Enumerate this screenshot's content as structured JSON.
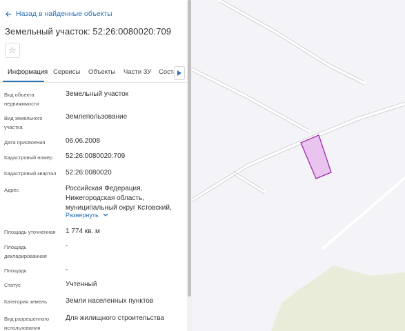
{
  "header": {
    "back_label": "Назад в найденные объекты",
    "title": "Земельный участок: 52:26:0080020:709"
  },
  "tabs": [
    {
      "label": "Информация",
      "active": true
    },
    {
      "label": "Сервисы"
    },
    {
      "label": "Объекты"
    },
    {
      "label": "Части ЗУ"
    },
    {
      "label": "Соста"
    }
  ],
  "details": [
    {
      "label": "Вид объекта недвижимости",
      "value": "Земельный участок"
    },
    {
      "label": "Вид земельного участка",
      "value": "Землепользование"
    },
    {
      "label": "Дата присвоения",
      "value": "06.06.2008"
    },
    {
      "label": "Кадастровый номер",
      "value": "52:26:0080020:709"
    },
    {
      "label": "Кадастровый квартал",
      "value": "52:26:0080020"
    },
    {
      "label": "Адрес",
      "value": "Российская Федерация, Нижегородская область, муниципальный округ Кстовский,"
    },
    {
      "label": "Площадь уточненная",
      "value": "1 774 кв. м"
    },
    {
      "label": "Площадь декларированная",
      "value": "-"
    },
    {
      "label": "Площадь",
      "value": "-"
    },
    {
      "label": "Статус",
      "value": "Учтенный"
    },
    {
      "label": "Категория земель",
      "value": "Земли населенных пунктов"
    },
    {
      "label": "Вид разрешенного использования",
      "value": "Для жилищного строительства"
    }
  ],
  "address_expand_label": "Развернуть",
  "colors": {
    "accent": "#2a73b8",
    "parcel_fill": "#e8c4ee",
    "parcel_stroke": "#a02aa8",
    "map_background": "#f4f3f7",
    "map_green": "#e9ecd9"
  }
}
